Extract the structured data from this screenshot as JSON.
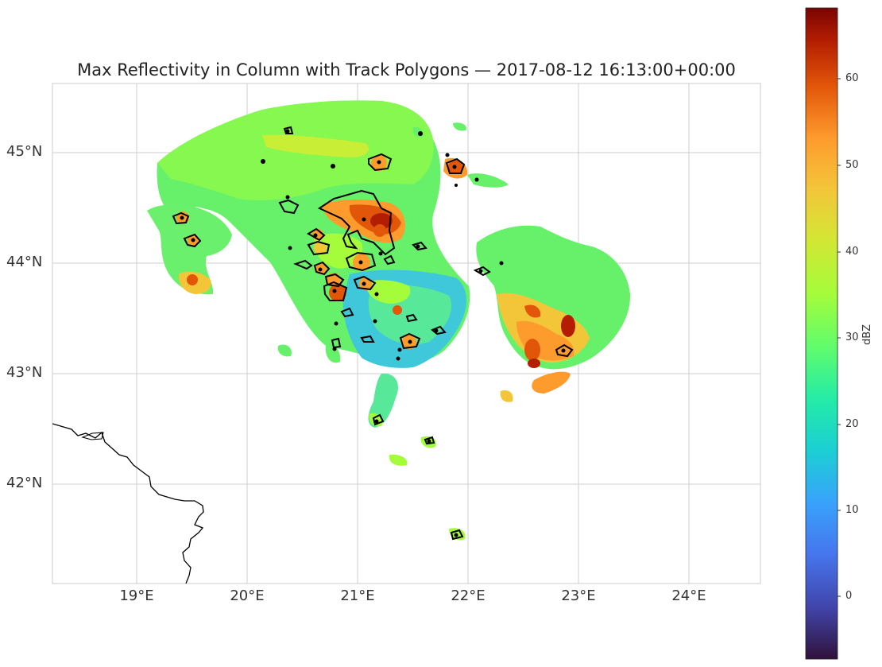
{
  "title": "Max Reflectivity in Column with Track Polygons — 2017-08-12 16:13:00+00:00",
  "map": {
    "lon_ticks": [
      "19°E",
      "20°E",
      "21°E",
      "22°E",
      "23°E",
      "24°E"
    ],
    "lat_ticks": [
      "45°N",
      "44°N",
      "43°N",
      "42°N"
    ],
    "extent": {
      "lon": [
        18.24,
        24.64
      ],
      "lat": [
        41.12,
        45.62
      ]
    },
    "grid": true,
    "features": [
      "coastline",
      "radar-reflectivity-field",
      "storm-track-polygons",
      "storm-centroids"
    ]
  },
  "colorbar": {
    "label": "dBZ",
    "ticks": [
      "0",
      "10",
      "20",
      "30",
      "40",
      "50",
      "60"
    ],
    "range": [
      -8,
      68
    ],
    "colormap": "turbo"
  }
}
